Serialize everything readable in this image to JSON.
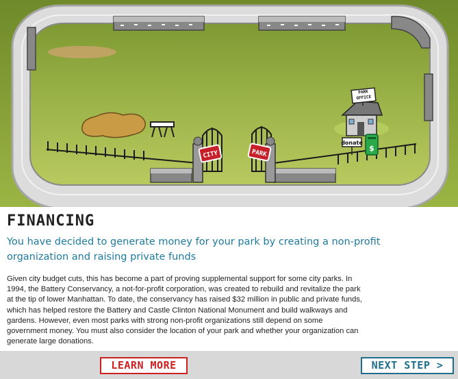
{
  "scene": {
    "gate_left_sign": "CITY",
    "gate_right_sign": "PARK",
    "office_sign": "PARK OFFICE",
    "donate_sign": "donate",
    "donate_bin_symbol": "$",
    "colors": {
      "grass": "#8ea83a",
      "road": "#dcdcdc",
      "sign_red": "#c8202a"
    }
  },
  "panel": {
    "heading": "FINANCING",
    "subheading": "You have decided to generate money for your park by creating a non-profit organization and raising private funds",
    "body": "Given city budget cuts, this has become a part of proving supplemental support for some city parks. In 1994, the Battery Conservancy, a not-for-profit corporation, was created to rebuild and revitalize the park at the tip of lower Manhattan. To date, the conservancy has raised $32 million in public and private funds, which has helped restore the Battery and Castle Clinton National Monument and build walkways and gardens. However, even most parks with strong non-profit organizations still depend on some government money. You must also consider the location of your park and whether your organization can generate large donations."
  },
  "footer": {
    "learn_more": "LEARN MORE",
    "next_step": "NEXT STEP >"
  }
}
